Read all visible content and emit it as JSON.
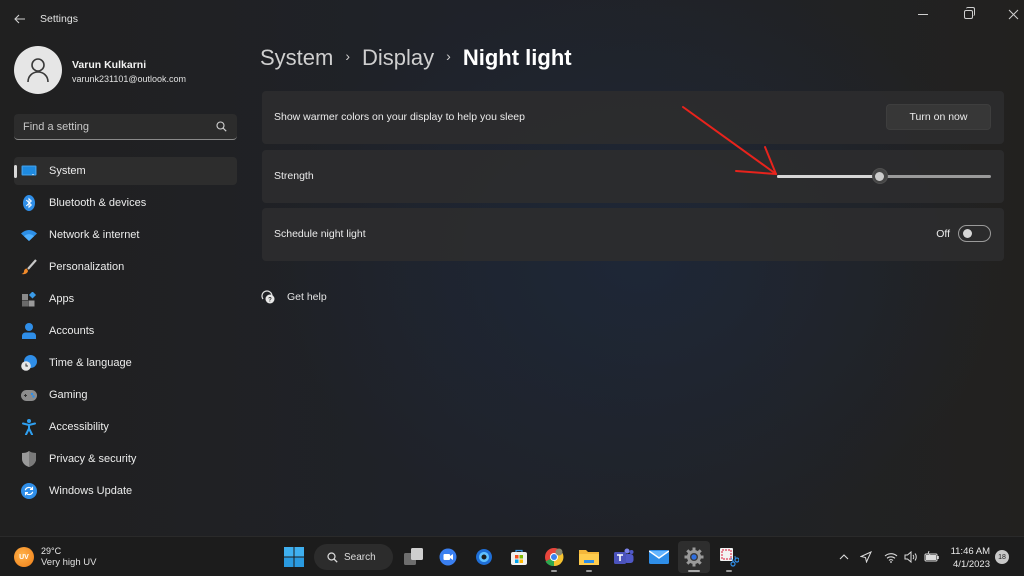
{
  "window": {
    "title": "Settings",
    "controls": {
      "minimize": "minimize",
      "maximize": "restore",
      "close": "close"
    }
  },
  "profile": {
    "name": "Varun Kulkarni",
    "email": "varunk231101@outlook.com"
  },
  "search": {
    "placeholder": "Find a setting",
    "value": ""
  },
  "sidebar": {
    "items": [
      {
        "label": "System",
        "icon": "monitor-icon",
        "active": true
      },
      {
        "label": "Bluetooth & devices",
        "icon": "bluetooth-icon"
      },
      {
        "label": "Network & internet",
        "icon": "wifi-icon"
      },
      {
        "label": "Personalization",
        "icon": "paintbrush-icon"
      },
      {
        "label": "Apps",
        "icon": "apps-icon"
      },
      {
        "label": "Accounts",
        "icon": "person-icon"
      },
      {
        "label": "Time & language",
        "icon": "clock-globe-icon"
      },
      {
        "label": "Gaming",
        "icon": "gamepad-icon"
      },
      {
        "label": "Accessibility",
        "icon": "accessibility-icon"
      },
      {
        "label": "Privacy & security",
        "icon": "shield-icon"
      },
      {
        "label": "Windows Update",
        "icon": "update-icon"
      }
    ]
  },
  "breadcrumb": {
    "items": [
      "System",
      "Display",
      "Night light"
    ],
    "separator": "›"
  },
  "main": {
    "night_light_row": {
      "label": "Show warmer colors on your display to help you sleep",
      "button_label": "Turn on now"
    },
    "strength_row": {
      "label": "Strength",
      "value_percent": 48
    },
    "schedule_row": {
      "label": "Schedule night light",
      "state_label": "Off",
      "enabled": false
    },
    "get_help_label": "Get help"
  },
  "annotation": {
    "type": "red-arrow",
    "color": "#e8231c",
    "points_to": "strength-slider"
  },
  "taskbar": {
    "weather": {
      "temp": "29°C",
      "desc": "Very high UV",
      "badge": "UV"
    },
    "search_label": "Search",
    "apps": [
      {
        "name": "start",
        "icon": "windows-icon"
      },
      {
        "name": "task-view",
        "icon": "task-view-icon"
      },
      {
        "name": "teams-meet",
        "icon": "meet-icon"
      },
      {
        "name": "copilot",
        "icon": "copilot-icon"
      },
      {
        "name": "store",
        "icon": "store-icon"
      },
      {
        "name": "chrome",
        "icon": "chrome-icon",
        "running": true
      },
      {
        "name": "file-explorer",
        "icon": "folder-icon",
        "running": true
      },
      {
        "name": "teams",
        "icon": "teams-icon"
      },
      {
        "name": "mail",
        "icon": "mail-icon"
      },
      {
        "name": "settings",
        "icon": "gear-icon",
        "running": true,
        "active": true
      },
      {
        "name": "snipping-tool",
        "icon": "snip-icon",
        "running": true
      }
    ],
    "clock": {
      "time": "11:46 AM",
      "date": "4/1/2023"
    },
    "notification_count": "18"
  }
}
